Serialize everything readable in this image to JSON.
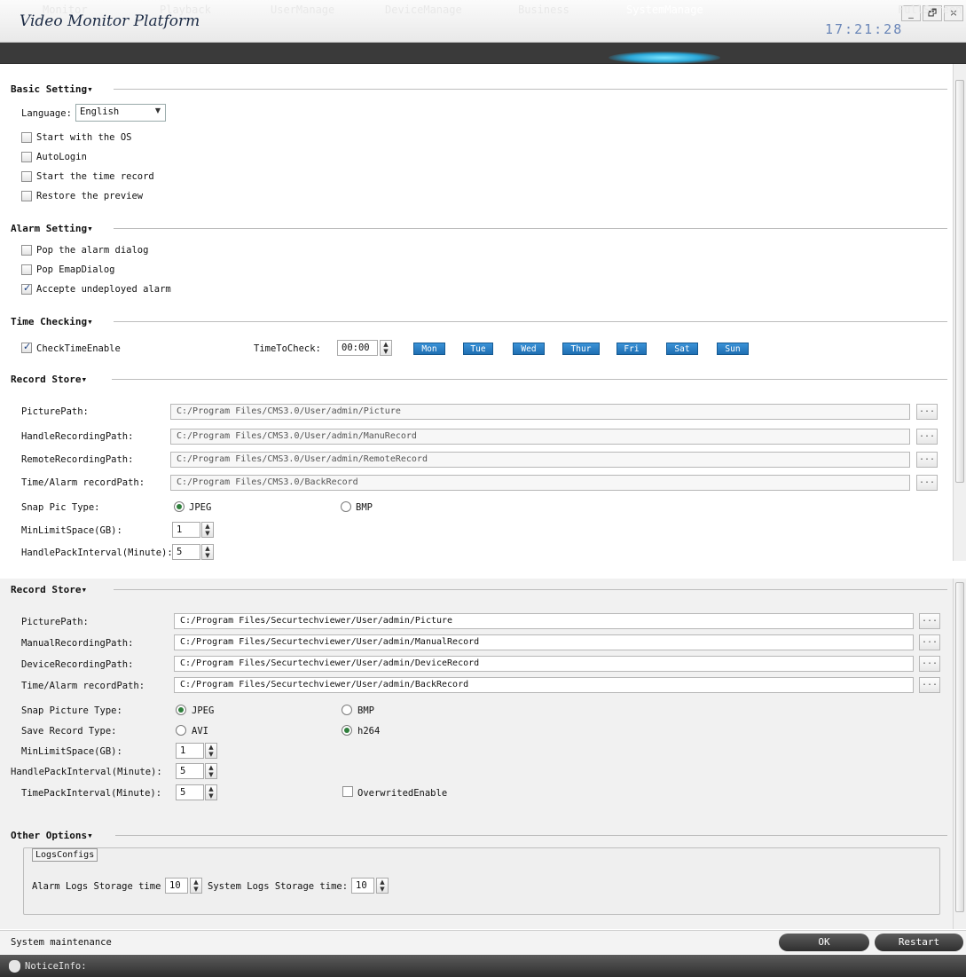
{
  "app": {
    "title": "Video Monitor Platform",
    "clock": "17:21:28",
    "win_buttons": [
      "_",
      "🗗",
      "×"
    ]
  },
  "nav": {
    "items": [
      "Monitor",
      "Playback",
      "UserManage",
      "DeviceManage",
      "Business",
      "SystemManage",
      "FullScreen"
    ],
    "active": "SystemManage"
  },
  "basic": {
    "title": "Basic Setting▾",
    "language_label": "Language:",
    "language_value": "English",
    "options": [
      {
        "label": "Start with the OS",
        "checked": false
      },
      {
        "label": "AutoLogin",
        "checked": false
      },
      {
        "label": "Start the time record",
        "checked": false
      },
      {
        "label": "Restore the preview",
        "checked": false
      }
    ]
  },
  "alarm": {
    "title": "Alarm Setting▾",
    "options": [
      {
        "label": "Pop the alarm dialog",
        "checked": false
      },
      {
        "label": "Pop EmapDialog",
        "checked": false
      },
      {
        "label": "Accepte undeployed alarm",
        "checked": true
      }
    ]
  },
  "time": {
    "title": "Time Checking▾",
    "enable_label": "CheckTimeEnable",
    "enable_checked": true,
    "to_check_label": "TimeToCheck:",
    "to_check_value": "00:00",
    "days": [
      "Mon",
      "Tue",
      "Wed",
      "Thur",
      "Fri",
      "Sat",
      "Sun"
    ]
  },
  "record1": {
    "title": "Record Store▾",
    "paths": [
      {
        "label": "PicturePath:",
        "value": "C:/Program Files/CMS3.0/User/admin/Picture"
      },
      {
        "label": "HandleRecordingPath:",
        "value": "C:/Program Files/CMS3.0/User/admin/ManuRecord"
      },
      {
        "label": "RemoteRecordingPath:",
        "value": "C:/Program Files/CMS3.0/User/admin/RemoteRecord"
      },
      {
        "label": "Time/Alarm recordPath:",
        "value": "C:/Program Files/CMS3.0/BackRecord"
      }
    ],
    "browse": "...",
    "snap_label": "Snap Pic Type:",
    "snap_jpeg": "JPEG",
    "snap_bmp": "BMP",
    "min_label": "MinLimitSpace(GB):",
    "min_value": "1",
    "handle_label": "HandlePackInterval(Minute):",
    "handle_value": "5"
  },
  "record2": {
    "title": "Record Store▾",
    "paths": [
      {
        "label": "PicturePath:",
        "value": "C:/Program Files/Securtechviewer/User/admin/Picture"
      },
      {
        "label": "ManualRecordingPath:",
        "value": "C:/Program Files/Securtechviewer/User/admin/ManualRecord"
      },
      {
        "label": "DeviceRecordingPath:",
        "value": "C:/Program Files/Securtechviewer/User/admin/DeviceRecord"
      },
      {
        "label": "Time/Alarm recordPath:",
        "value": "C:/Program Files/Securtechviewer/User/admin/BackRecord"
      }
    ],
    "browse": "...",
    "snap_label": "Snap Picture Type:",
    "snap_jpeg": "JPEG",
    "snap_bmp": "BMP",
    "save_label": "Save Record Type:",
    "save_avi": "AVI",
    "save_h264": "h264",
    "min_label": "MinLimitSpace(GB):",
    "min_value": "1",
    "handle_label": "HandlePackInterval(Minute):",
    "handle_value": "5",
    "timepack_label": "TimePackInterval(Minute):",
    "timepack_value": "5",
    "overwrite_label": "OverwritedEnable"
  },
  "other": {
    "title": "Other Options▾",
    "group": "LogsConfigs",
    "alarm_logs_label": "Alarm Logs Storage time",
    "alarm_logs_value": "10",
    "system_logs_label": "System Logs Storage time:",
    "system_logs_value": "10"
  },
  "status": {
    "text": "System maintenance",
    "ok": "OK",
    "restart": "Restart"
  },
  "notice": {
    "label": "NoticeInfo:"
  }
}
